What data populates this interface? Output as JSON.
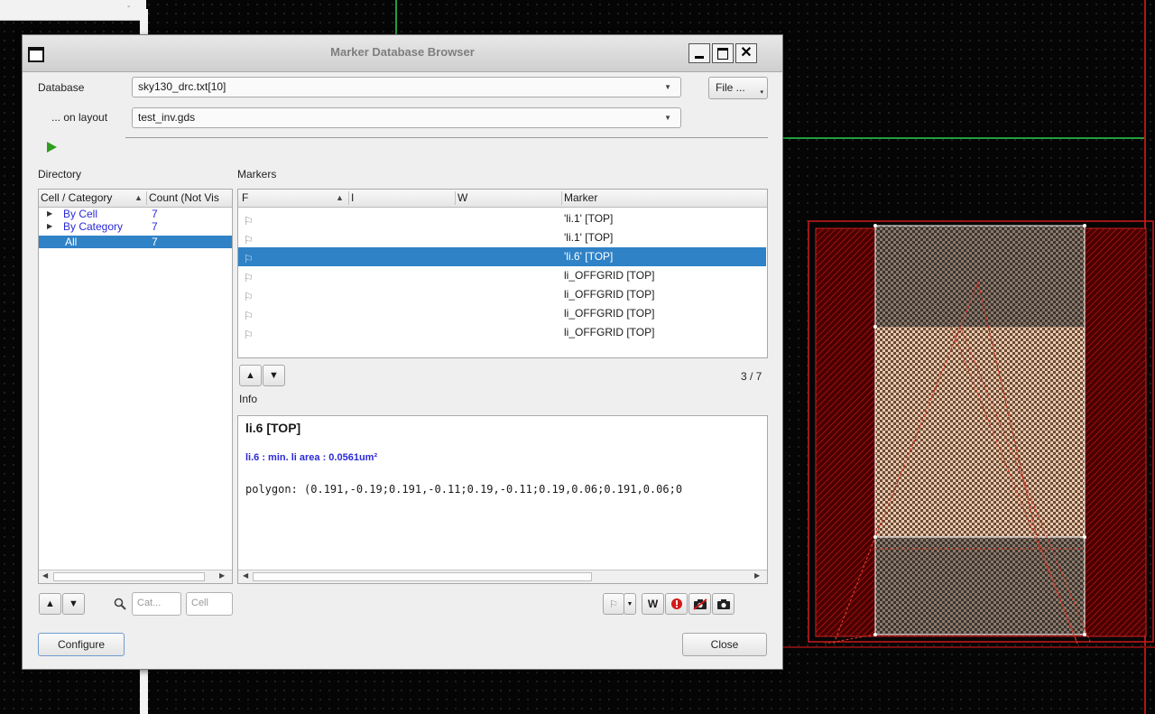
{
  "top_strip": {
    "mark": "-"
  },
  "dialog": {
    "title": "Marker Database Browser",
    "database_label": "Database",
    "database_value": "sky130_drc.txt[10]",
    "layout_label": "... on layout",
    "layout_value": "test_inv.gds",
    "file_button": "File ...",
    "directory_label": "Directory",
    "markers_label": "Markers",
    "info_label": "Info",
    "configure_button": "Configure",
    "close_button": "Close"
  },
  "directory": {
    "columns": [
      "Cell / Category",
      "Count (Not Vis"
    ],
    "rows": [
      {
        "label": "By Cell",
        "count": "7"
      },
      {
        "label": "By Category",
        "count": "7"
      },
      {
        "label": "All",
        "count": "7"
      }
    ],
    "filter_category_placeholder": "Cat...",
    "filter_cell_placeholder": "Cell"
  },
  "markers": {
    "columns": [
      "F",
      "I",
      "W",
      "Marker"
    ],
    "rows": [
      {
        "marker": "'li.1' [TOP]"
      },
      {
        "marker": "'li.1' [TOP]"
      },
      {
        "marker": "'li.6' [TOP]"
      },
      {
        "marker": "li_OFFGRID [TOP]"
      },
      {
        "marker": "li_OFFGRID [TOP]"
      },
      {
        "marker": "li_OFFGRID [TOP]"
      },
      {
        "marker": "li_OFFGRID [TOP]"
      }
    ],
    "selected_index": 2,
    "position": "3 / 7"
  },
  "info": {
    "heading": "li.6 [TOP]",
    "rule": "li.6 : min. li area : 0.0561um²",
    "polygon": "polygon: (0.191,-0.19;0.191,-0.11;0.19,-0.11;0.19,0.06;0.191,0.06;0"
  },
  "colors": {
    "selection": "#2f82c6",
    "category_link": "#2a2ad8",
    "layout_red": "#b01616",
    "layout_green": "#1f9e3e"
  },
  "icons": {
    "run": "play-icon",
    "up": "up-arrow-icon",
    "down": "down-arrow-icon",
    "search": "search-icon",
    "flag": "flag-icon",
    "waive": "waive-icon",
    "important": "important-icon",
    "snapshot_remove": "snapshot-remove-icon",
    "snapshot": "camera-icon"
  }
}
